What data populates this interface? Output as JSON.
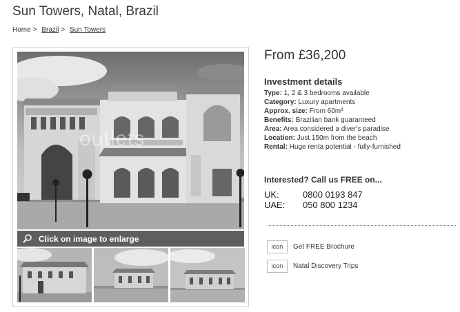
{
  "page": {
    "title": "Sun Towers, Natal, Brazil"
  },
  "breadcrumb": {
    "home": "Home",
    "items": [
      "Brazil",
      "Sun Towers"
    ]
  },
  "gallery": {
    "watermark": "outlets",
    "enlarge_label": "Click on image to enlarge"
  },
  "listing": {
    "price": "From £36,200",
    "investment_title": "Investment details",
    "details": [
      {
        "label": "Type:",
        "value": "1, 2 & 3 bedrooms available"
      },
      {
        "label": "Category:",
        "value": "Luxury apartments"
      },
      {
        "label": "Approx. size:",
        "value": "From 60m²"
      },
      {
        "label": "Benefits:",
        "value": "Brazilian bank guaranteed"
      },
      {
        "label": "Area:",
        "value": "Area considered a diver's paradise"
      },
      {
        "label": "Location:",
        "value": "Just 150m from the beach"
      },
      {
        "label": "Rental:",
        "value": "Huge renta potential - fully-furnished"
      }
    ]
  },
  "contact": {
    "heading": "Interested? Call us FREE on...",
    "phones": [
      {
        "label": "UK:",
        "number": "0800 0193 847"
      },
      {
        "label": "UAE:",
        "number": "050 800 1234"
      }
    ]
  },
  "actions": [
    {
      "icon": "icon",
      "label": "Get FREE Brochure"
    },
    {
      "icon": "icon",
      "label": "Natal Discovery Trips"
    }
  ]
}
